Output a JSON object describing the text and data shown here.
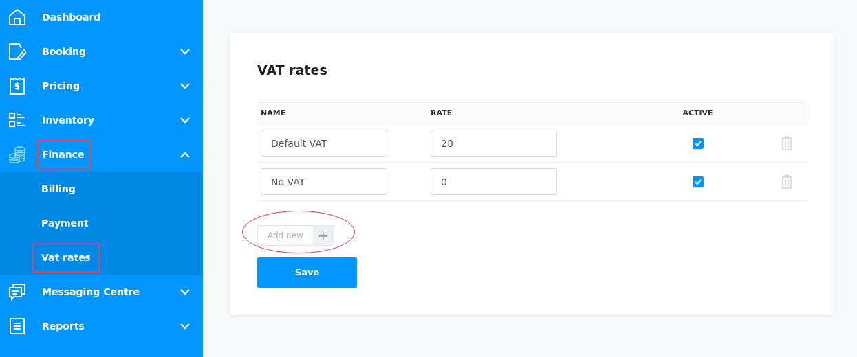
{
  "sidebar": {
    "items": [
      {
        "label": "Dashboard",
        "kind": "link",
        "annotated": false
      },
      {
        "label": "Booking",
        "kind": "group",
        "expanded": false,
        "annotated": false
      },
      {
        "label": "Pricing",
        "kind": "group",
        "expanded": false,
        "annotated": false
      },
      {
        "label": "Inventory",
        "kind": "group",
        "expanded": false,
        "annotated": false
      },
      {
        "label": "Finance",
        "kind": "group",
        "expanded": true,
        "annotated": true,
        "children": [
          {
            "label": "Billing",
            "annotated": false
          },
          {
            "label": "Payment",
            "annotated": false
          },
          {
            "label": "Vat rates",
            "annotated": true
          }
        ]
      },
      {
        "label": "Messaging Centre",
        "kind": "group",
        "expanded": false,
        "annotated": false
      },
      {
        "label": "Reports",
        "kind": "group",
        "expanded": false,
        "annotated": false
      }
    ]
  },
  "card": {
    "title": "VAT rates",
    "table": {
      "columns": [
        "NAME",
        "RATE",
        "ACTIVE"
      ],
      "rows": [
        {
          "name": "Default VAT",
          "rate": "20",
          "active": true
        },
        {
          "name": "No VAT",
          "rate": "0",
          "active": true
        }
      ]
    },
    "add_new": {
      "placeholder": "Add new",
      "button": "+",
      "annotated": true
    },
    "save_button": "Save"
  }
}
